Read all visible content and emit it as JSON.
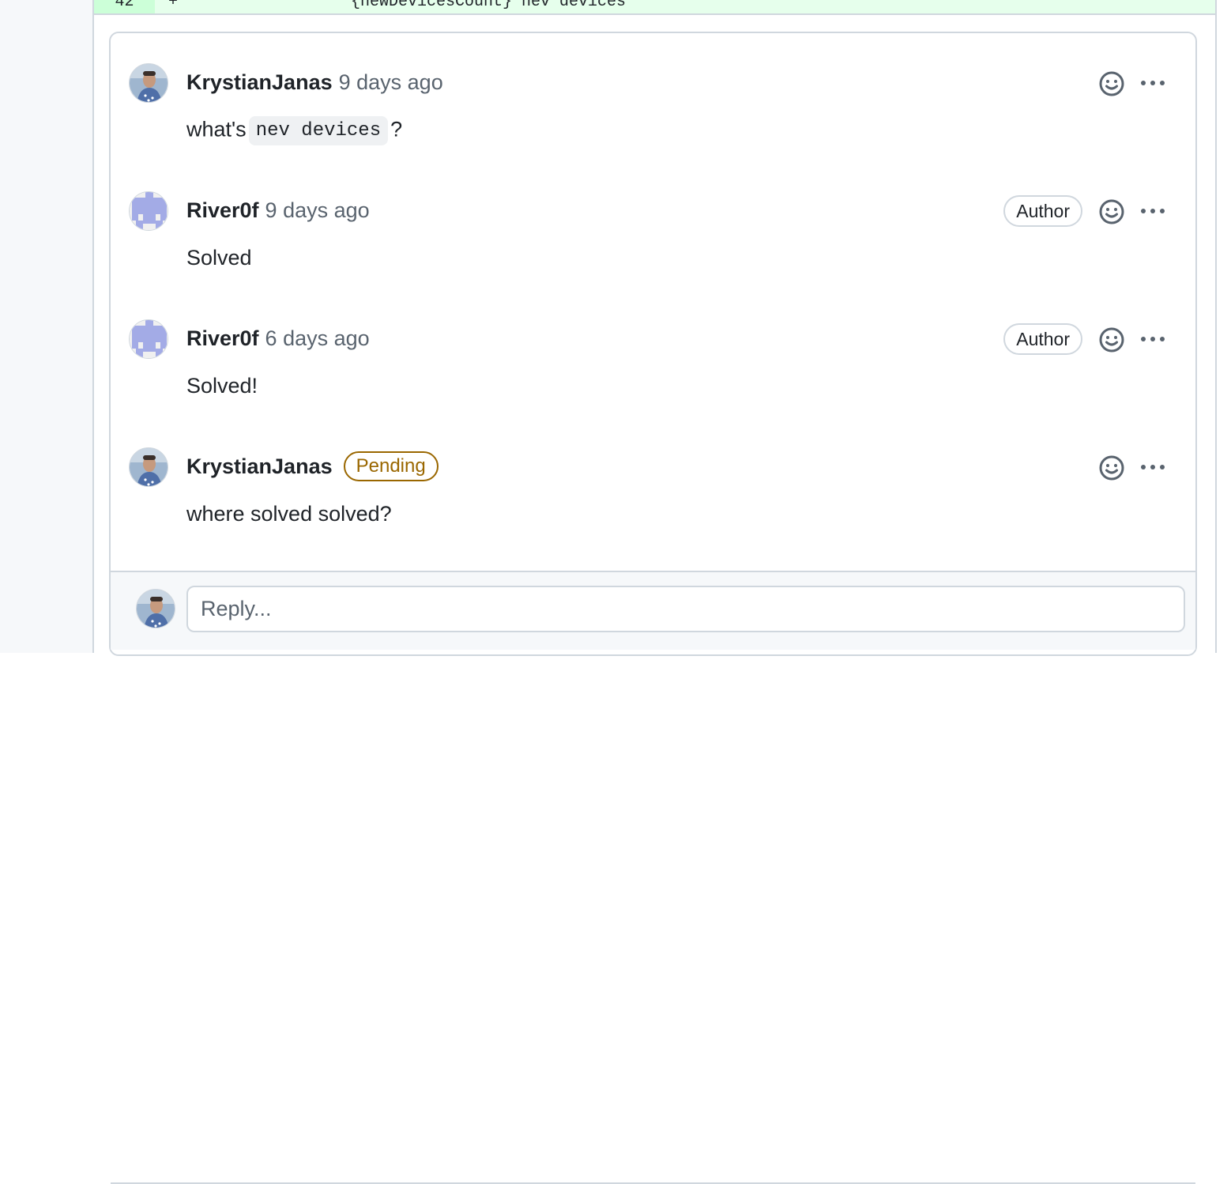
{
  "diff": {
    "line_number": "42",
    "marker": "+",
    "code": "{newDevicesCount} nev devices"
  },
  "comments": [
    {
      "author": "KrystianJanas",
      "time": "9 days ago",
      "body_prefix": "what's",
      "body_code": "nev devices",
      "body_suffix": "?"
    },
    {
      "author": "River0f",
      "time": "9 days ago",
      "badge": "Author",
      "body": "Solved"
    },
    {
      "author": "River0f",
      "time": "6 days ago",
      "badge": "Author",
      "body": "Solved!"
    },
    {
      "author": "KrystianJanas",
      "status": "Pending",
      "body": "where solved solved?"
    }
  ],
  "reply": {
    "placeholder": "Reply..."
  },
  "colors": {
    "pending": "#9a6700",
    "identicon": "#a3abe6",
    "diff_added_bg": "#e6ffec"
  },
  "icons": [
    "smiley-icon",
    "kebab-horizontal-icon"
  ]
}
